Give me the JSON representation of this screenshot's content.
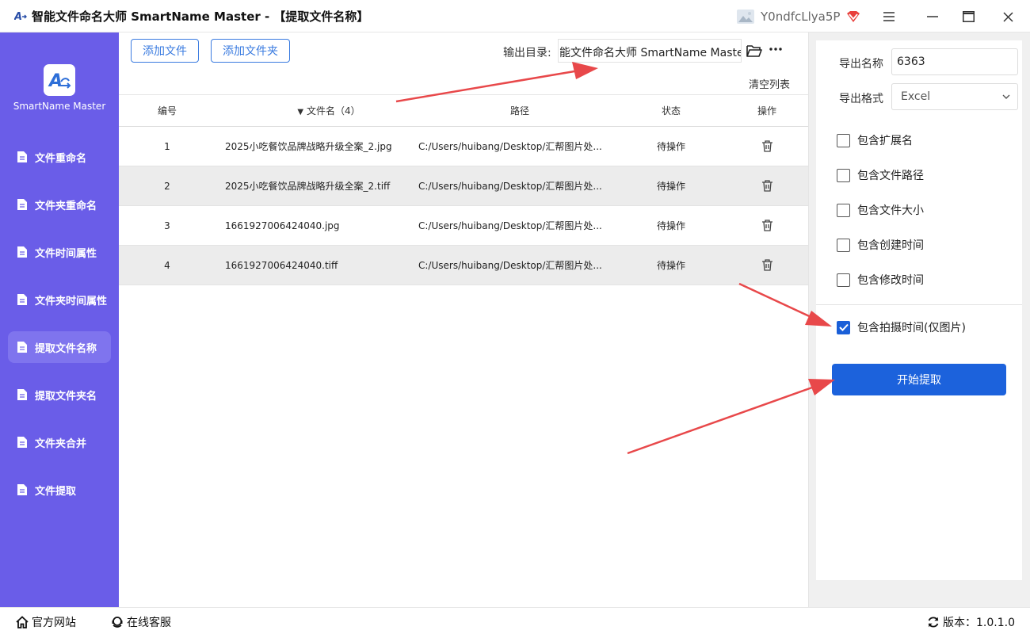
{
  "titlebar": {
    "title": "智能文件命名大师 SmartName Master - 【提取文件名称】",
    "username": "Y0ndfcLlya5P",
    "icons": [
      "app-logo-icon",
      "avatar-icon",
      "vip-badge-icon",
      "menu-icon",
      "maximize-icon",
      "close-icon"
    ]
  },
  "sidebar": {
    "logo_text": "SmartName Master",
    "items": [
      {
        "label": "文件重命名"
      },
      {
        "label": "文件夹重命名"
      },
      {
        "label": "文件时间属性"
      },
      {
        "label": "文件夹时间属性"
      },
      {
        "label": "提取文件名称"
      },
      {
        "label": "提取文件夹名"
      },
      {
        "label": "文件夹合并"
      },
      {
        "label": "文件提取"
      }
    ],
    "active_index": 4
  },
  "toolbar": {
    "add_file": "添加文件",
    "add_folder": "添加文件夹",
    "output_label": "输出目录:",
    "output_path": "能文件命名大师 SmartName Master",
    "clear_list": "清空列表"
  },
  "table": {
    "headers": {
      "num": "编号",
      "name": "文件名（4）",
      "path": "路径",
      "status": "状态",
      "op": "操作"
    },
    "rows": [
      {
        "num": "1",
        "name": "2025小吃餐饮品牌战略升级全案_2.jpg",
        "path": "C:/Users/huibang/Desktop/汇帮图片处...",
        "status": "待操作"
      },
      {
        "num": "2",
        "name": "2025小吃餐饮品牌战略升级全案_2.tiff",
        "path": "C:/Users/huibang/Desktop/汇帮图片处...",
        "status": "待操作"
      },
      {
        "num": "3",
        "name": "1661927006424040.jpg",
        "path": "C:/Users/huibang/Desktop/汇帮图片处...",
        "status": "待操作"
      },
      {
        "num": "4",
        "name": "1661927006424040.tiff",
        "path": "C:/Users/huibang/Desktop/汇帮图片处...",
        "status": "待操作"
      }
    ]
  },
  "right_panel": {
    "export_name_label": "导出名称",
    "export_name_value": "6363",
    "export_format_label": "导出格式",
    "export_format_value": "Excel",
    "options": [
      {
        "label": "包含扩展名",
        "checked": false
      },
      {
        "label": "包含文件路径",
        "checked": false
      },
      {
        "label": "包含文件大小",
        "checked": false
      },
      {
        "label": "包含创建时间",
        "checked": false
      },
      {
        "label": "包含修改时间",
        "checked": false
      },
      {
        "label": "包含拍摄时间(仅图片)",
        "checked": true
      }
    ],
    "start_button": "开始提取"
  },
  "footer": {
    "website": "官方网站",
    "support": "在线客服",
    "version": "版本：1.0.1.0"
  },
  "colors": {
    "sidebar": "#6a5de8",
    "accent": "#1c62dc",
    "outline_button": "#3a7be0",
    "arrow": "#e8484a"
  }
}
